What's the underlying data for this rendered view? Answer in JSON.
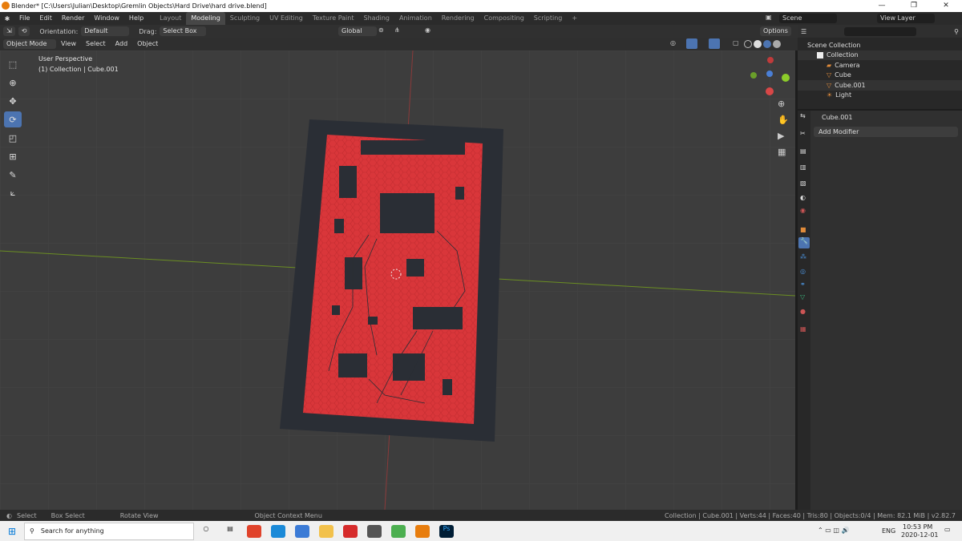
{
  "window": {
    "title": "Blender* [C:\\Users\\Julian\\Desktop\\Gremlin Objects\\Hard Drive\\hard drive.blend]"
  },
  "menus": [
    "File",
    "Edit",
    "Render",
    "Window",
    "Help"
  ],
  "workspaces": [
    "Layout",
    "Modeling",
    "Sculpting",
    "UV Editing",
    "Texture Paint",
    "Shading",
    "Animation",
    "Rendering",
    "Compositing",
    "Scripting"
  ],
  "active_workspace": "Modeling",
  "scene": {
    "label": "Scene",
    "view_layer": "View Layer"
  },
  "tool_header": {
    "orientation_label": "Orientation:",
    "orientation_value": "Default",
    "drag_label": "Drag:",
    "drag_value": "Select Box",
    "transform": "Global",
    "options": "Options"
  },
  "view_header": {
    "mode": "Object Mode",
    "items": [
      "View",
      "Select",
      "Add",
      "Object"
    ]
  },
  "viewport": {
    "perspective": "User Perspective",
    "collection": "(1) Collection | Cube.001"
  },
  "outliner": {
    "root": "Scene Collection",
    "items": [
      {
        "label": "Collection"
      },
      {
        "label": "Camera"
      },
      {
        "label": "Cube"
      },
      {
        "label": "Cube.001"
      },
      {
        "label": "Light"
      }
    ]
  },
  "properties": {
    "object_name": "Cube.001",
    "add_modifier": "Add Modifier"
  },
  "statusbar": {
    "select": "Select",
    "box_select": "Box Select",
    "rotate_view": "Rotate View",
    "context_menu": "Object Context Menu",
    "stats": "Collection | Cube.001 | Verts:44 | Faces:40 | Tris:80 | Objects:0/4 | Mem: 82.1 MiB | v2.82.7"
  },
  "taskbar": {
    "search_placeholder": "Search for anything",
    "lang": "ENG",
    "time": "10:53 PM",
    "date": "2020-12-01"
  },
  "colors": {
    "accent": "#4c74b1",
    "pcb": "#d9363a",
    "viewport_bg": "#3d3d3d"
  }
}
